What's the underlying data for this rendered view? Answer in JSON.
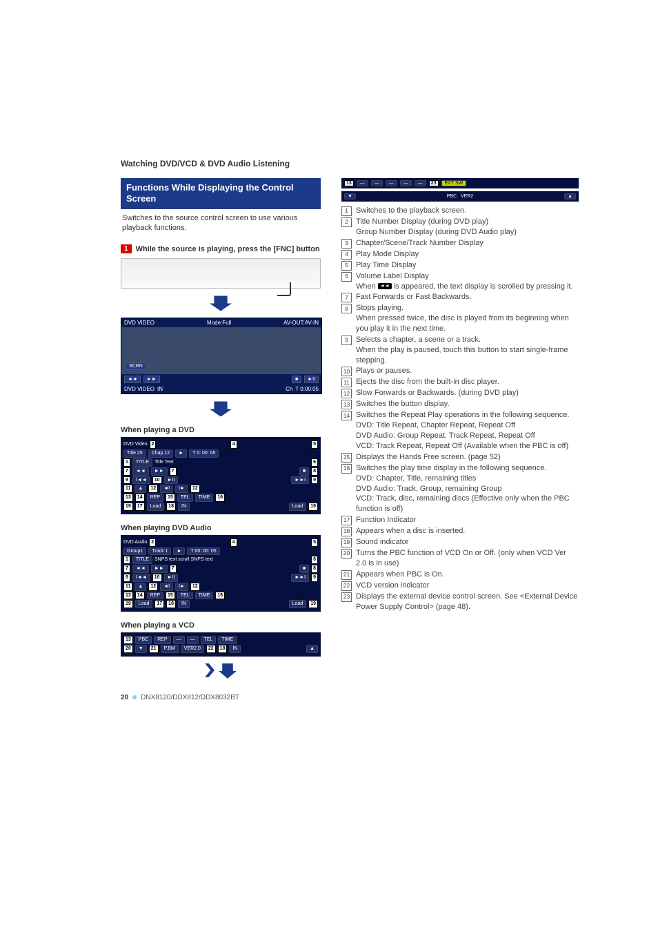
{
  "section_title": "Watching DVD/VCD & DVD Audio Listening",
  "blue_bar": "Functions While Displaying the Control Screen",
  "intro": "Switches to the source control screen to use various playback functions.",
  "step1_badge": "1",
  "step1_text": "While the source is playing, press the [FNC] button",
  "ss": {
    "title_left": "DVD VIDEO",
    "title_mid": "Mode:Full",
    "title_right": "AV-OUT:AV-IN",
    "scrn": "SCRN",
    "footer_source": "DVD VIDEO",
    "footer_play": "IN",
    "footer_ch": "Ch",
    "footer_time": "T 0:00:05"
  },
  "sub_dvd": "When playing a DVD",
  "sub_dvda": "When playing DVD Audio",
  "sub_vcd": "When playing a VCD",
  "dvd_block": {
    "header": "DVD Video",
    "title": "Title   25",
    "chap": "Chap   12",
    "play": "►",
    "time": "T   0: 00: 05",
    "title_text": "Title Text",
    "labels": [
      "TITLE",
      "REP",
      "TEL",
      "TIME",
      "Load",
      "IN"
    ]
  },
  "dvda_block": {
    "header": "DVD Audio",
    "group": "Group1",
    "track": "Track   1",
    "play": "►",
    "time": "T   00: 00: 05",
    "scroll_text": "SNPS text scroll SNPS text",
    "labels": [
      "TITLE",
      "REP",
      "TEL",
      "TIME",
      "Load",
      "IN"
    ]
  },
  "vcd_block": {
    "labels": [
      "PBC",
      "REP",
      "TEL",
      "TIME",
      "P.BM",
      "VER2.0",
      "IN"
    ],
    "num20": "20",
    "num21": "21",
    "num22": "22"
  },
  "top_annot": {
    "pbc": "PBC",
    "ver": "VER2",
    "ext": "EXT SW",
    "num23": "23"
  },
  "items": [
    {
      "n": "1",
      "t": "Switches to the playback screen."
    },
    {
      "n": "2",
      "t": "Title Number Display (during DVD play)\nGroup Number Display (during DVD Audio play)"
    },
    {
      "n": "3",
      "t": "Chapter/Scene/Track Number Display"
    },
    {
      "n": "4",
      "t": "Play Mode Display"
    },
    {
      "n": "5",
      "t": "Play Time Display"
    },
    {
      "n": "6",
      "t": "Volume Label Display\nWhen ⟨scroll⟩ is appeared, the text display is scrolled by pressing it."
    },
    {
      "n": "7",
      "t": "Fast Forwards or Fast Backwards."
    },
    {
      "n": "8",
      "t": "Stops playing.\nWhen pressed twice, the disc is played from its beginning when you play it in the next time."
    },
    {
      "n": "9",
      "t": "Selects a chapter, a scene or a track.\nWhen the play is paused, touch this button to start single-frame stepping."
    },
    {
      "n": "10",
      "t": "Plays or pauses."
    },
    {
      "n": "11",
      "t": "Ejects the disc from the built-in disc player."
    },
    {
      "n": "12",
      "t": "Slow Forwards or Backwards. (during DVD play)"
    },
    {
      "n": "13",
      "t": "Switches the button display."
    },
    {
      "n": "14",
      "t": "Switches the Repeat Play operations in the following sequence.\nDVD:  Title Repeat, Chapter Repeat, Repeat Off\nDVD Audio:  Group Repeat, Track Repeat, Repeat Off\nVCD:  Track Repeat, Repeat Off (Available when the PBC is off)"
    },
    {
      "n": "15",
      "t": "Displays the Hands Free screen. (page 52)"
    },
    {
      "n": "16",
      "t": "Switches the play time display in the following sequence.\nDVD:  Chapter, Title, remaining titles\nDVD Audio:  Track, Group, remaining Group\nVCD:  Track, disc, remaining discs (Effective only when the PBC function is off)"
    },
    {
      "n": "17",
      "t": "Function Indicator"
    },
    {
      "n": "18",
      "t": "Appears when a disc is inserted."
    },
    {
      "n": "19",
      "t": "Sound indicator"
    },
    {
      "n": "20",
      "t": "Turns the PBC function of VCD On or Off. (only when VCD Ver 2.0 is in use)"
    },
    {
      "n": "21",
      "t": "Appears when PBC is On."
    },
    {
      "n": "22",
      "t": "VCD version indicator"
    },
    {
      "n": "23",
      "t": "Displays the external device control screen. See <External Device Power Supply Control> (page 48)."
    }
  ],
  "footer": {
    "page": "20",
    "model": "DNX8120/DDX812/DDX8032BT"
  }
}
